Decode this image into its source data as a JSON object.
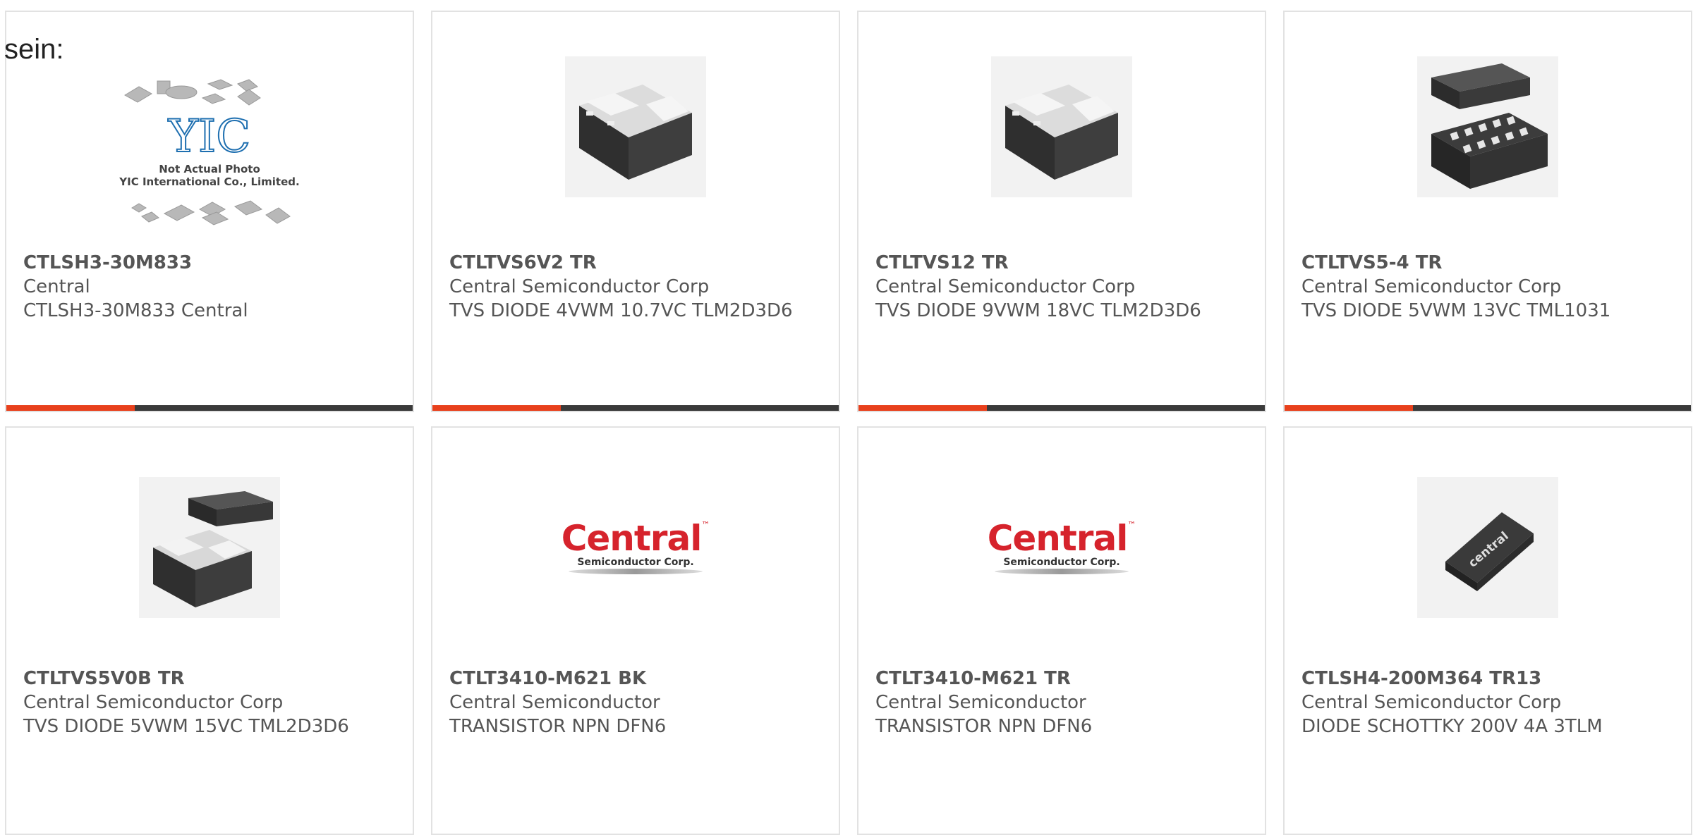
{
  "intro": {
    "text": "sein:"
  },
  "products": [
    {
      "part_number": "CTLSH3-30M833",
      "manufacturer": "Central",
      "description": "CTLSH3-30M833 Central",
      "image": {
        "type": "not-actual-photo",
        "logo_text": "YIC",
        "caption_line1": "Not Actual Photo",
        "caption_line2": "YIC International Co., Limited."
      }
    },
    {
      "part_number": "CTLTVS6V2 TR",
      "manufacturer": "Central Semiconductor Corp",
      "description": "TVS DIODE 4VWM 10.7VC TLM2D3D6",
      "image": {
        "type": "package-2-pad"
      }
    },
    {
      "part_number": "CTLTVS12 TR",
      "manufacturer": "Central Semiconductor Corp",
      "description": "TVS DIODE 9VWM 18VC TLM2D3D6",
      "image": {
        "type": "package-2-pad"
      }
    },
    {
      "part_number": "CTLTVS5-4 TR",
      "manufacturer": "Central Semiconductor Corp",
      "description": "TVS DIODE 5VWM 13VC TML1031",
      "image": {
        "type": "package-10-pad"
      }
    },
    {
      "part_number": "CTLTVS5V0B TR",
      "manufacturer": "Central Semiconductor Corp",
      "description": "TVS DIODE 5VWM 15VC TML2D3D6",
      "image": {
        "type": "package-2-pad-with-top"
      }
    },
    {
      "part_number": "CTLT3410-M621 BK",
      "manufacturer": "Central Semiconductor",
      "description": "TRANSISTOR NPN DFN6",
      "image": {
        "type": "brand-logo",
        "logo_text": "Central",
        "logo_subtext": "Semiconductor Corp.",
        "logo_mark": "™"
      }
    },
    {
      "part_number": "CTLT3410-M621 TR",
      "manufacturer": "Central Semiconductor",
      "description": "TRANSISTOR NPN DFN6",
      "image": {
        "type": "brand-logo",
        "logo_text": "Central",
        "logo_subtext": "Semiconductor Corp.",
        "logo_mark": "™"
      }
    },
    {
      "part_number": "CTLSH4-200M364 TR13",
      "manufacturer": "Central Semiconductor Corp",
      "description": "DIODE SCHOTTKY 200V 4A 3TLM",
      "image": {
        "type": "package-marked",
        "marking": "central"
      }
    }
  ],
  "colors": {
    "accent": "#e8401c",
    "bar": "#3a3a3a",
    "border": "#e2e2e2",
    "text": "#555555"
  }
}
